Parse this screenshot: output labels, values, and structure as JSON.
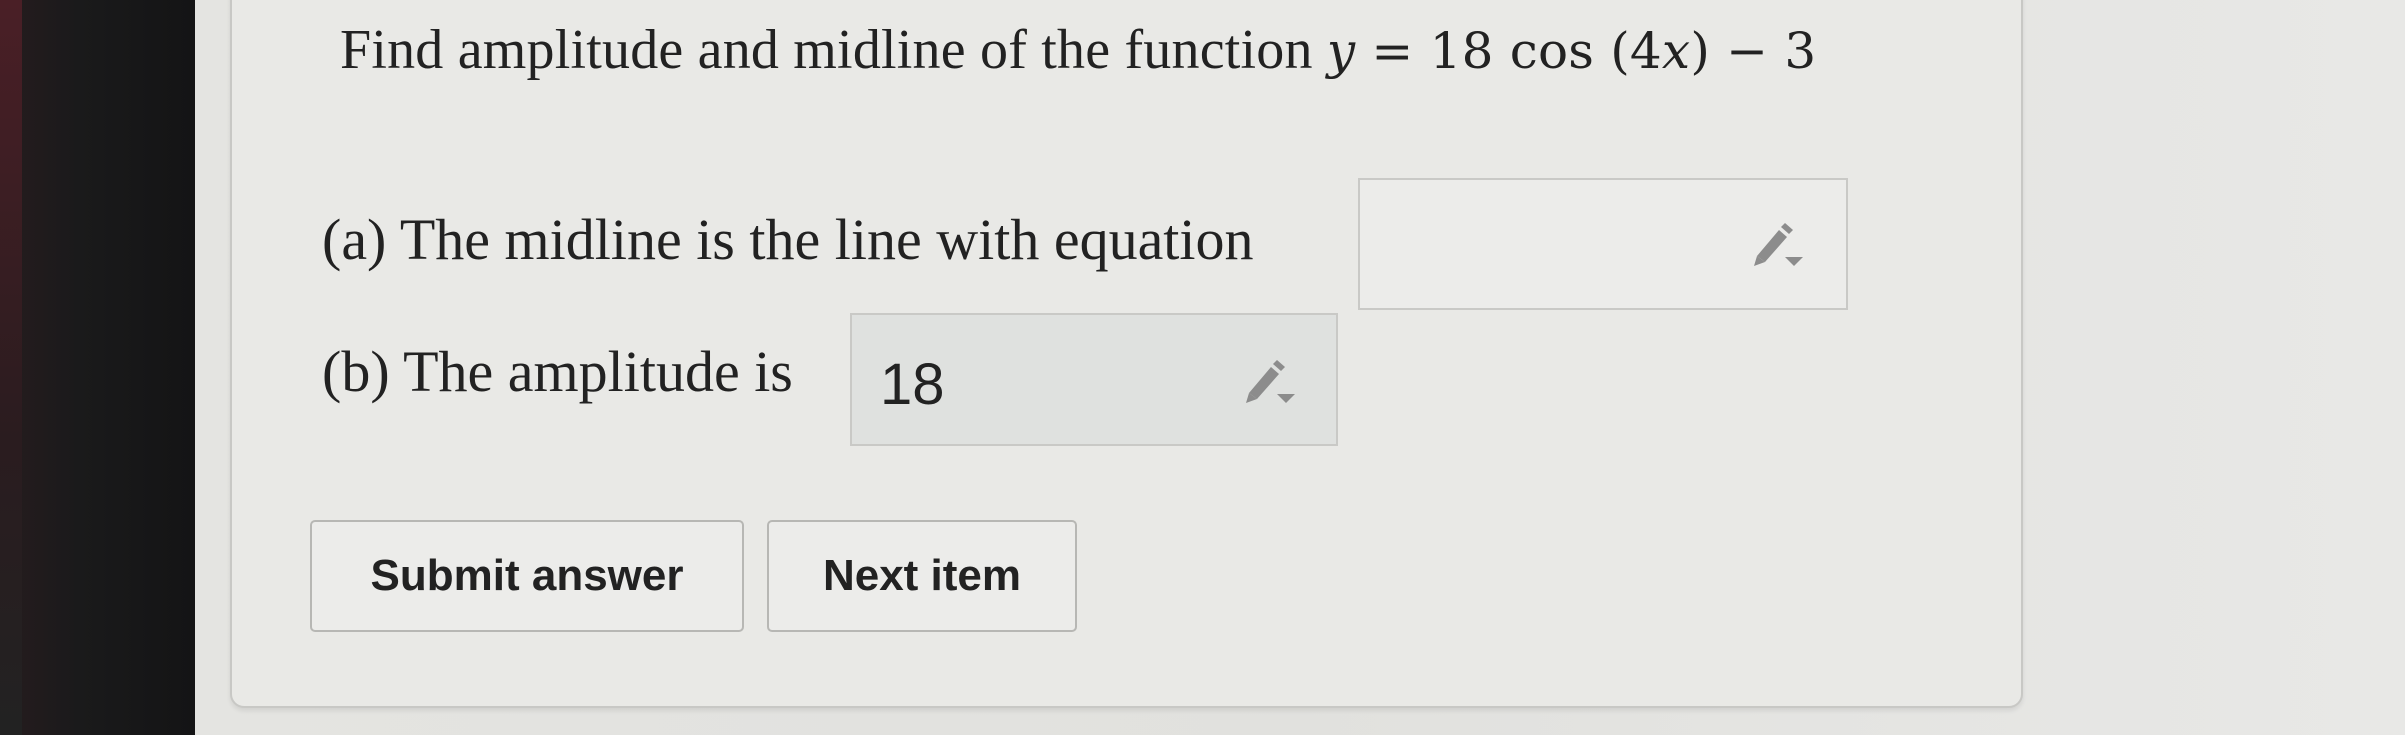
{
  "question": {
    "prefix": "Find amplitude and midline of the function ",
    "math": {
      "y": "y",
      "eq": " = 18 cos (4",
      "x": "x",
      "tail": ") − 3"
    }
  },
  "part_a": {
    "label": "(a) The midline is the line with equation",
    "value": "",
    "edit_icon": "pencil-dropdown-icon"
  },
  "part_b": {
    "label": "(b) The amplitude is",
    "value": "18",
    "edit_icon": "pencil-dropdown-icon"
  },
  "buttons": {
    "submit_label": "Submit answer",
    "next_label": "Next item"
  },
  "colors": {
    "card_background": "#e9e9e6",
    "active_box_background": "#dfe1df",
    "pencil_gray": "#8c8c8c"
  }
}
